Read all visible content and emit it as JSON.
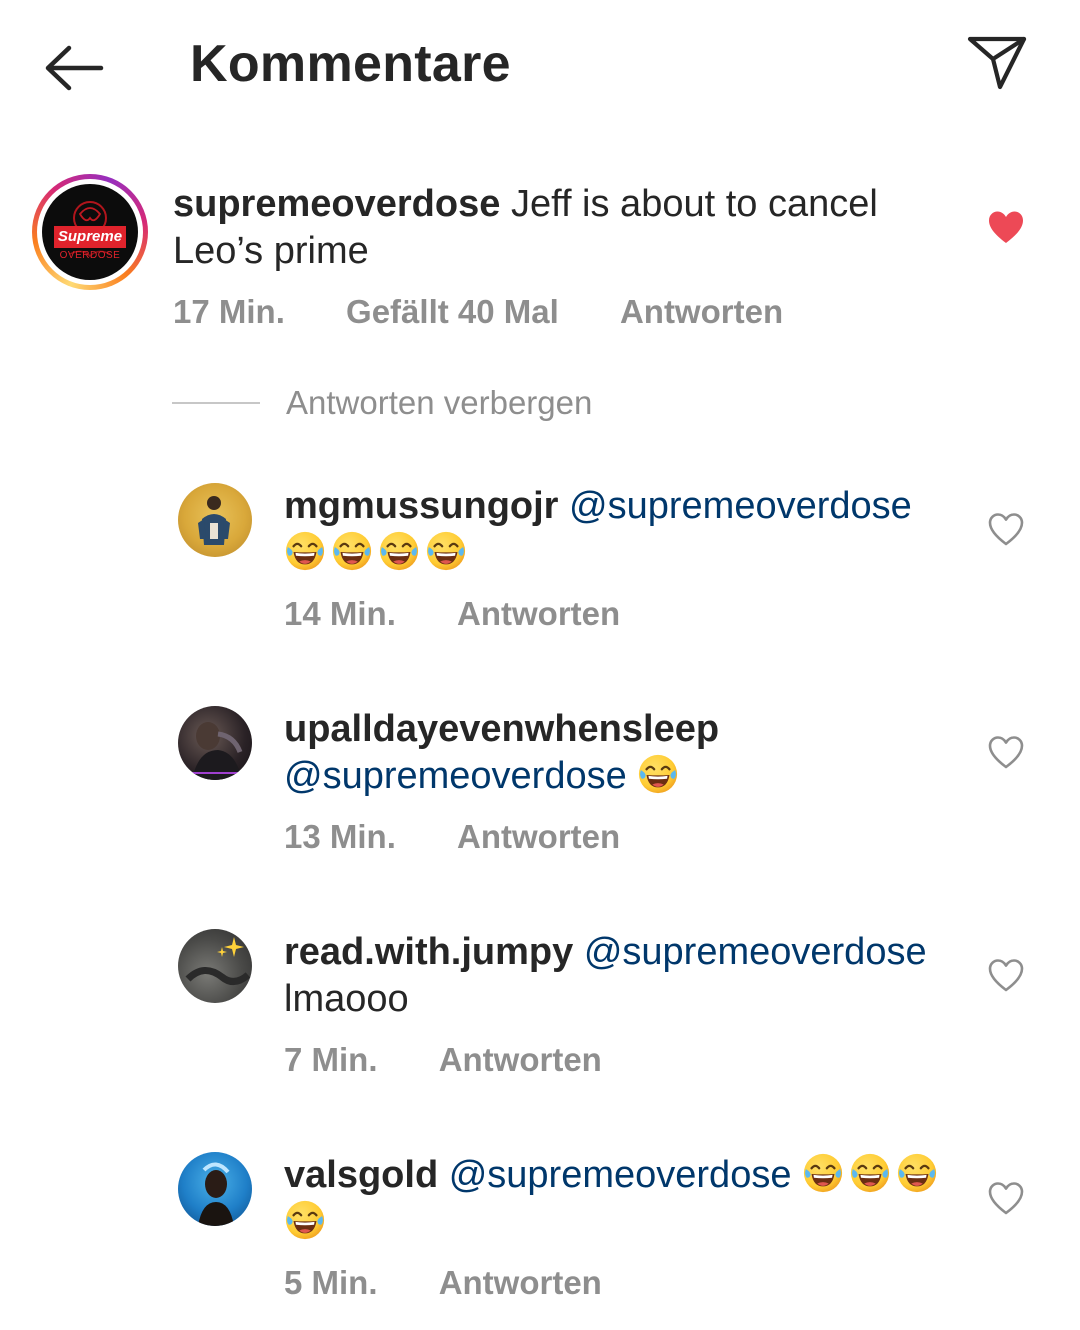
{
  "header": {
    "title": "Kommentare",
    "back_icon": "arrow-left-icon",
    "share_icon": "paper-plane-icon"
  },
  "main_comment": {
    "username": "supremeoverdose",
    "text_line1": "Jeff is about to cancel",
    "text_line2": "Leo’s prime",
    "time": "17 Min.",
    "likes": "Gefällt 40 Mal",
    "reply_label": "Antworten",
    "liked": true,
    "avatar_label_top": "Supreme",
    "avatar_label_bottom": "OVERDOSE"
  },
  "hide_replies_label": "Antworten verbergen",
  "replies": [
    {
      "username": "mgmussungojr",
      "mention": "@supremeoverdose",
      "text": "",
      "emoji_count": 4,
      "time": "14 Min.",
      "reply_label": "Antworten"
    },
    {
      "username": "upalldayevenwhensleep",
      "mention": "@supremeoverdose",
      "text": "",
      "emoji_count": 1,
      "time": "13 Min.",
      "reply_label": "Antworten"
    },
    {
      "username": "read.with.jumpy",
      "mention": "@supremeoverdose",
      "text": "lmaooo",
      "emoji_count": 0,
      "time": "7 Min.",
      "reply_label": "Antworten"
    },
    {
      "username": "valsgold",
      "mention": "@supremeoverdose",
      "text": "",
      "emoji_count": 4,
      "time": "5 Min.",
      "reply_label": "Antworten"
    }
  ],
  "colors": {
    "text": "#262626",
    "secondary": "#8e8e8e",
    "mention": "#00376b",
    "like_red": "#ed4956",
    "story_ring_start": "#feda75",
    "story_ring_end": "#d62976"
  }
}
